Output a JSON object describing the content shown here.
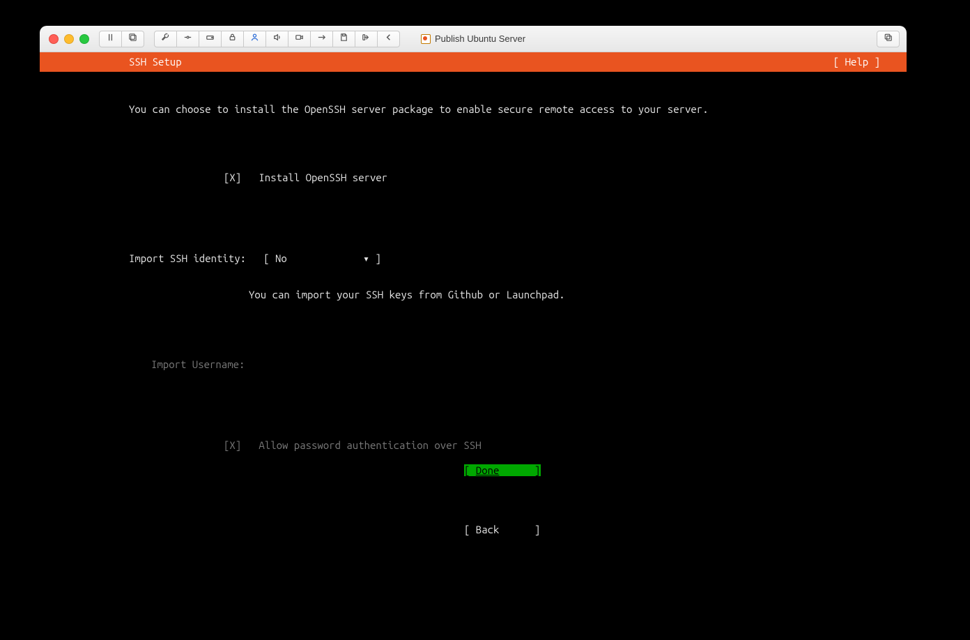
{
  "window": {
    "title": "Publish Ubuntu Server"
  },
  "header": {
    "title": "SSH Setup",
    "help": "[ Help ]"
  },
  "content": {
    "intro": "You can choose to install the OpenSSH server package to enable secure remote access to your server.",
    "install_box": "[X]",
    "install_label": "Install OpenSSH server",
    "import_label": "Import SSH identity:",
    "import_value": "No",
    "import_select_open": "[ ",
    "import_select_arrow": "▾",
    "import_select_close": " ]",
    "import_hint": "You can import your SSH keys from Github or Launchpad.",
    "username_label": "Import Username:",
    "allow_box": "[X]",
    "allow_label": "Allow password authentication over SSH"
  },
  "footer": {
    "done": "Done",
    "back": "Back"
  }
}
